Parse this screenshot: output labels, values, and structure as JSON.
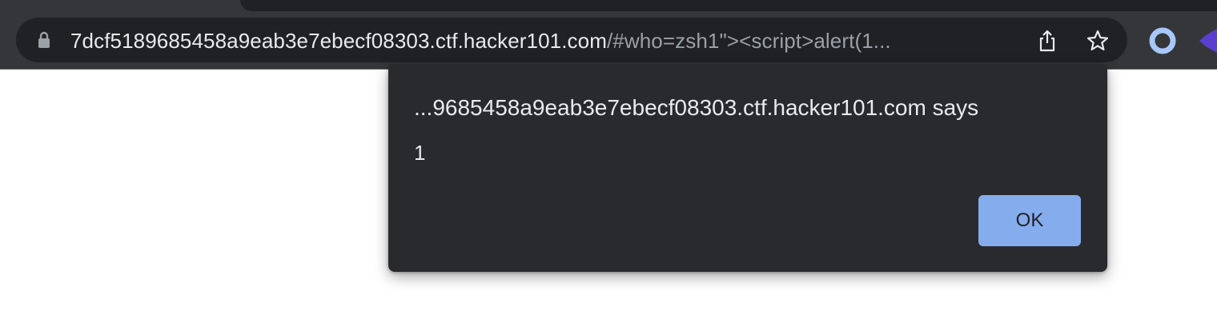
{
  "browser": {
    "address_bar": {
      "host": "7dcf5189685458a9eab3e7ebecf08303.ctf.hacker101.com",
      "path": "/#who=zsh1\"><script>alert(1..."
    },
    "icons": {
      "lock": "lock-icon",
      "share": "share-icon",
      "bookmark": "star-icon",
      "extension_1": "extension-circle-icon",
      "extension_2": "extension-icon"
    }
  },
  "alert_dialog": {
    "title": "...9685458a9eab3e7ebecf08303.ctf.hacker101.com says",
    "message": "1",
    "ok_label": "OK"
  },
  "colors": {
    "toolbar": "#35363a",
    "omnibox": "#202124",
    "dialog": "#292a2d",
    "button": "#8ab4f8",
    "page": "#ffffff"
  }
}
